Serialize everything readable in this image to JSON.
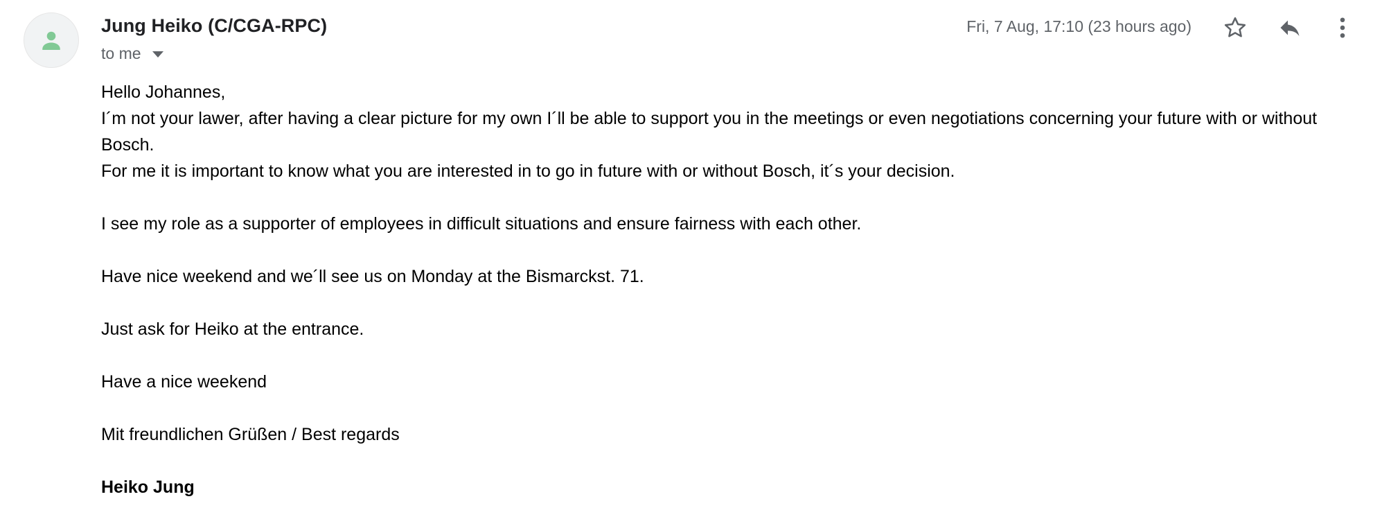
{
  "sender": {
    "name": "Jung Heiko (C/CGA-RPC)",
    "avatar_icon": "person-icon",
    "avatar_color": "#81c995"
  },
  "recipient": {
    "label": "to me",
    "toggle_icon": "caret-down-icon"
  },
  "date": "Fri, 7 Aug, 17:10 (23 hours ago)",
  "actions": {
    "star_icon": "star-icon",
    "reply_icon": "reply-icon",
    "more_icon": "more-vertical-icon"
  },
  "body": {
    "greeting": "Hello Johannes,",
    "para1": "I´m not your lawer, after having a clear picture for my own I´ll be able to support you in the meetings or even negotiations concerning your future with or without Bosch.",
    "para2": "For me it is important to know what you are interested in to go in future with or without Bosch, it´s your decision.",
    "para3": "I see my role as a supporter of employees in difficult situations and ensure fairness with each other.",
    "para4": "Have nice weekend and we´ll see us on Monday at the Bismarckst. 71.",
    "para5": "Just ask for Heiko at the entrance.",
    "para6": "Have a nice weekend",
    "closing": "Mit freundlichen Grüßen / Best regards",
    "signature": "Heiko Jung"
  }
}
